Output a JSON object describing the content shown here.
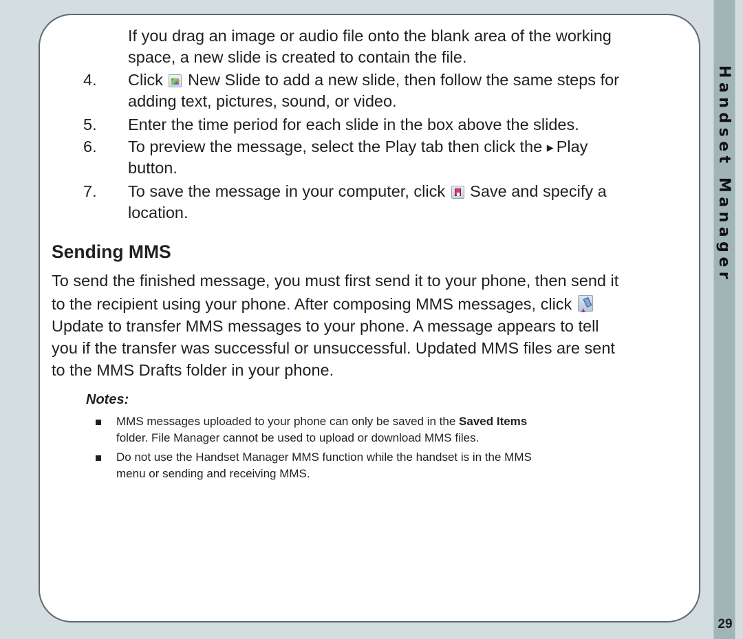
{
  "page": {
    "side_title": "Handset Manager",
    "page_number": "29"
  },
  "intro_continuation": {
    "line1": "If you drag an image or audio file onto the blank area of the working",
    "line2": "space, a new slide is created to contain the file."
  },
  "steps": [
    {
      "number": "4.",
      "line1_before_icon": "Click",
      "icon": "new-slide-icon",
      "line1_after_icon": " New Slide to add a new slide, then follow the same steps for",
      "line2": "adding text, pictures, sound, or video."
    },
    {
      "number": "5.",
      "line1": "Enter the time period for each slide in the box above the slides."
    },
    {
      "number": "6.",
      "line1_before_icon": "To preview the message, select the  Play tab then click the ",
      "icon": "play-icon",
      "line1_after_icon": "Play",
      "line2": "button."
    },
    {
      "number": "7.",
      "line1_before_icon": "To save the message in your computer, click",
      "icon": "save-icon",
      "line1_after_icon": " Save and specify a",
      "line2": "location."
    }
  ],
  "section": {
    "heading": "Sending MMS",
    "paragraph": {
      "line1": "To send the finished message, you must first send it to your phone, then send it",
      "line2_before_dot": "to the recipient using your phone",
      "line2_dot": ".",
      "line2_after_dot": " After composing MMS messages, click ",
      "line2_icon": "update-icon",
      "line3": "Update to transfer MMS messages to your phone.  A message appears to tell",
      "line4": "you if the transfer was successful or unsuccessful. Updated MMS files are sent",
      "line5": "to the MMS Drafts folder in your phone."
    }
  },
  "notes": {
    "title": "Notes:",
    "items": [
      {
        "line1_before_bold": "MMS messages uploaded to your phone can only be saved in the ",
        "line1_bold": "Saved Items",
        "line2": "folder. File Manager cannot be used to upload or download MMS files."
      },
      {
        "line1": "Do not use the Handset Manager MMS function while the handset is in the MMS",
        "line2": "menu or sending and receiving MMS."
      }
    ]
  },
  "colors": {
    "background": "#d4dddf",
    "side_strip": "#a1b5b7",
    "box_border": "#5f6779",
    "text": "#231f20",
    "link_dot": "#2b2bd6"
  }
}
